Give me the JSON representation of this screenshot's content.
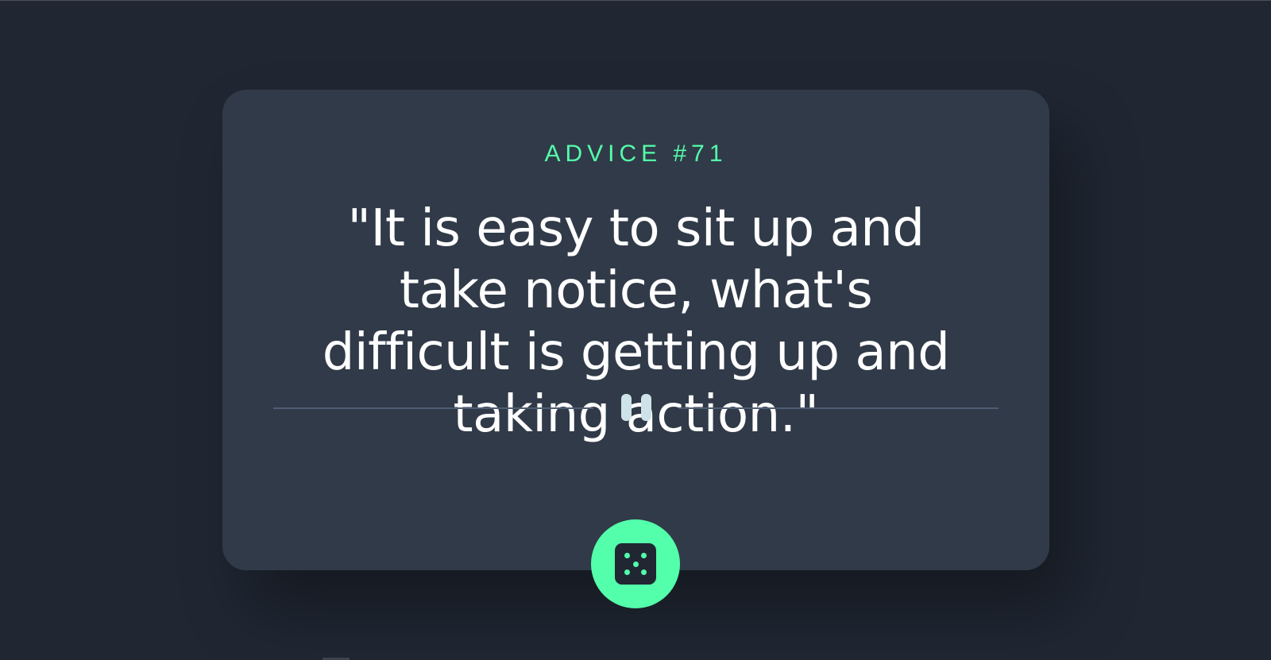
{
  "advice": {
    "id_label": "ADVICE #71",
    "quote": "\"It is easy to sit up and take notice, what's difficult is getting up and taking action.\""
  },
  "divider": {
    "icon": "pause-icon"
  },
  "button": {
    "icon": "dice-icon"
  },
  "colors": {
    "background": "#202733",
    "card": "#313a48",
    "accent": "#53ffaa",
    "text": "#ffffff",
    "divider": "#4f5d73",
    "pause": "#cee3e9"
  }
}
